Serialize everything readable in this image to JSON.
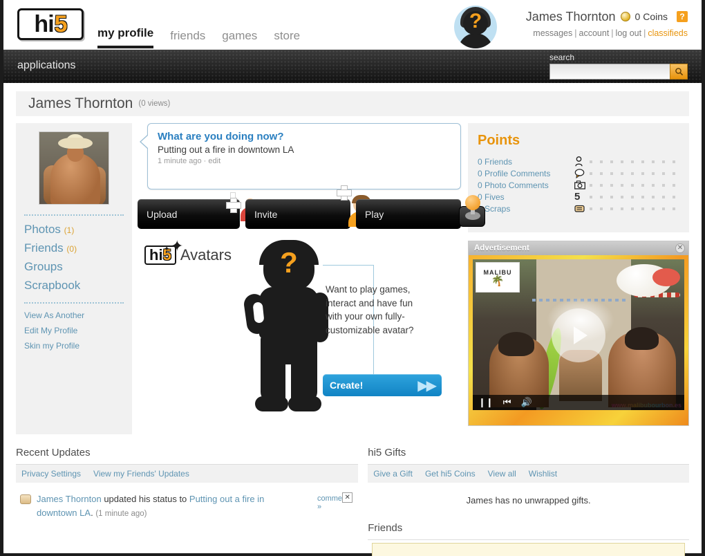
{
  "site": {
    "logo_hi": "hi",
    "logo_5": "5"
  },
  "nav": {
    "items": [
      {
        "label": "my profile",
        "active": true
      },
      {
        "label": "friends",
        "active": false
      },
      {
        "label": "games",
        "active": false
      },
      {
        "label": "store",
        "active": false
      }
    ]
  },
  "user": {
    "name": "James Thornton",
    "coins": "0 Coins",
    "help": "?",
    "avatar_q": "?",
    "links": [
      "messages",
      "account",
      "log out",
      "classifieds"
    ],
    "separator": "|"
  },
  "appsbar": {
    "label": "applications"
  },
  "search": {
    "label": "search",
    "value": "",
    "placeholder": "",
    "icon": "search-icon"
  },
  "profile_header": {
    "name": "James Thornton",
    "views": "(0 views)"
  },
  "sidebar": {
    "primary": [
      {
        "label": "Photos",
        "count": "(1)"
      },
      {
        "label": "Friends",
        "count": "(0)"
      },
      {
        "label": "Groups",
        "count": ""
      },
      {
        "label": "Scrapbook",
        "count": ""
      }
    ],
    "secondary": [
      {
        "label": "View As Another"
      },
      {
        "label": "Edit My Profile"
      },
      {
        "label": "Skin my Profile"
      }
    ]
  },
  "status": {
    "prompt": "What are you doing now?",
    "text": "Putting out a fire in downtown LA",
    "time": "1 minute ago",
    "dot": "·",
    "edit": "edit"
  },
  "actions": [
    {
      "label": "Upload",
      "icon": "photo-upload-icon"
    },
    {
      "label": "Invite",
      "icon": "person-add-icon"
    },
    {
      "label": "Play",
      "icon": "joystick-icon"
    }
  ],
  "avatars_promo": {
    "logo_hi": "hi",
    "logo_5": "5",
    "word": "Avatars",
    "figure_q": "?",
    "description": "Want to play games, interact and have fun with your own fully-customizable avatar?",
    "cta": "Create!",
    "cta_arrows": "▶▶"
  },
  "points": {
    "title": "Points",
    "rows": [
      {
        "label": "0 Friends",
        "icon": "person-icon",
        "glyph": "☃",
        "dots": 9
      },
      {
        "label": "0 Profile Comments",
        "icon": "speech-bubble-icon",
        "glyph": "◯",
        "dots": 9
      },
      {
        "label": "0 Photo Comments",
        "icon": "camera-icon",
        "glyph": "▣",
        "dots": 9
      },
      {
        "label": "0 Fives",
        "icon": "five-icon",
        "glyph": "5",
        "dots": 9
      },
      {
        "label": "1 Scraps",
        "icon": "scroll-icon",
        "glyph": "▤",
        "dots": 9
      }
    ]
  },
  "ad": {
    "title": "Advertisement",
    "close": "✕",
    "brand": "MALIBU",
    "brand_icon": "palm-tree-icon",
    "url": "www.malibubourbon.es",
    "controls": [
      {
        "name": "pause-button",
        "glyph": "❙❙"
      },
      {
        "name": "previous-button",
        "glyph": "⏮"
      },
      {
        "name": "volume-button",
        "glyph": "🔊"
      }
    ],
    "play": "play-button"
  },
  "recent_updates": {
    "title": "Recent Updates",
    "links": [
      "Privacy Settings",
      "View my Friends' Updates"
    ],
    "item": {
      "actor": "James Thornton",
      "verb": " updated his status to ",
      "object": "Putting out a fire in downtown LA",
      "period": ".",
      "time": "(1 minute ago)",
      "comment": "comment »",
      "close": "✕"
    }
  },
  "gifts": {
    "title": "hi5 Gifts",
    "links": [
      "Give a Gift",
      "Get hi5 Coins",
      "View all",
      "Wishlist"
    ],
    "empty": "James has no unwrapped gifts."
  },
  "friends_section": {
    "title": "Friends"
  },
  "colors": {
    "brand_orange": "#F5A01E",
    "link_blue": "#5e94b2",
    "heading_blue": "#2a7fc0",
    "panel_gray": "#f1f1f1",
    "dark": "#1c1c1c",
    "cta_blue": "#1184c4"
  }
}
